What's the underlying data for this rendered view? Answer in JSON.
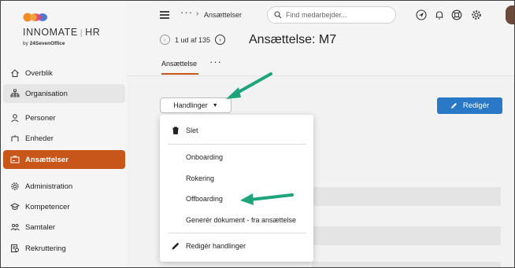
{
  "logo": {
    "name": "INNOMATE",
    "product": "HR",
    "by": "by",
    "brand_prefix": "24",
    "brand_suffix": "SevenOffice"
  },
  "sidebar": {
    "items": [
      {
        "label": "Overblik",
        "icon": "home-icon"
      },
      {
        "label": "Organisation",
        "icon": "org-chart-icon"
      },
      {
        "label": "Personer",
        "icon": "person-icon"
      },
      {
        "label": "Enheder",
        "icon": "unit-icon"
      },
      {
        "label": "Ansættelser",
        "icon": "id-card-icon"
      },
      {
        "label": "Administration",
        "icon": "gear-icon"
      },
      {
        "label": "Kompetencer",
        "icon": "graduation-cap-icon"
      },
      {
        "label": "Samtaler",
        "icon": "people-icon"
      },
      {
        "label": "Rekruttering",
        "icon": "recruit-icon"
      }
    ]
  },
  "topbar": {
    "breadcrumb": "Ansættelser",
    "search_placeholder": "Find medarbejder..."
  },
  "header": {
    "pager_text": "1 ud af 135",
    "title": "Ansættelse: M7",
    "tab_label": "Ansættelse"
  },
  "actions": {
    "handlinger_label": "Handlinger",
    "edit_label": "Redigér"
  },
  "menu": {
    "delete_label": "Slet",
    "onboarding_label": "Onboarding",
    "rotation_label": "Rokering",
    "offboarding_label": "Offboarding",
    "generate_doc_label": "Generér dokument - fra ansættelse",
    "edit_actions_label": "Redigér handlinger"
  },
  "colors": {
    "accent": "#c8551a",
    "primary_button": "#2979c7",
    "annotation_arrow": "#1fa37a"
  }
}
